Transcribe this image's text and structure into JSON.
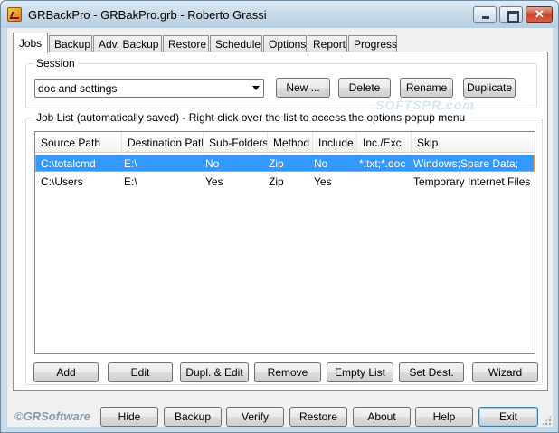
{
  "window": {
    "title": "GRBackPro - GRBakPro.grb - Roberto Grassi"
  },
  "tabs": [
    "Jobs",
    "Backup",
    "Adv. Backup",
    "Restore",
    "Schedule",
    "Options",
    "Report",
    "Progress"
  ],
  "active_tab": "Jobs",
  "watermark": "SOFTSPR.com",
  "session": {
    "label": "Session",
    "selected": "doc and settings",
    "new_label": "New ...",
    "delete_label": "Delete",
    "rename_label": "Rename",
    "duplicate_label": "Duplicate"
  },
  "joblist": {
    "label": "Job List (automatically saved) - Right click over the list to access the options popup menu",
    "columns": [
      "Source Path",
      "Destination Path",
      "Sub-Folders",
      "Method",
      "Include",
      "Inc./Exc",
      "Skip"
    ],
    "rows": [
      [
        "C:\\totalcmd",
        "E:\\",
        "No",
        "Zip",
        "No",
        "*.txt;*.doc",
        "Windows;Spare Data;"
      ],
      [
        "C:\\Users",
        "E:\\",
        "Yes",
        "Zip",
        "Yes",
        "",
        "Temporary Internet Files"
      ]
    ],
    "selected_row": 0
  },
  "job_buttons": {
    "add": "Add",
    "edit": "Edit",
    "dupl_edit": "Dupl. & Edit",
    "remove": "Remove",
    "empty_list": "Empty List",
    "set_dest": "Set Dest.",
    "wizard": "Wizard"
  },
  "footer": {
    "logo": "©GRSoftware",
    "hide": "Hide",
    "backup": "Backup",
    "verify": "Verify",
    "restore": "Restore",
    "about": "About",
    "help": "Help",
    "exit": "Exit"
  }
}
